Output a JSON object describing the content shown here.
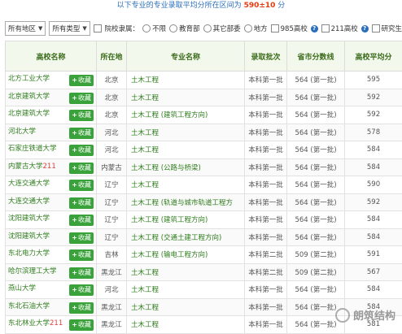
{
  "header": {
    "prefix": "以下专业的专业录取平均分所在区间为",
    "range": "590±10",
    "suffix": "分"
  },
  "filters": {
    "region_select": "所有地区",
    "type_select": "所有类型",
    "affiliation_label": "院校隶属：",
    "affiliation_options": [
      "不限",
      "教育部",
      "其它部委",
      "地方"
    ],
    "tags": [
      "985高校",
      "211高校",
      "研究生"
    ]
  },
  "table": {
    "columns": [
      "高校名称",
      "所在地",
      "专业名称",
      "录取批次",
      "省市分数线",
      "高校平均分"
    ],
    "fav_label": "收藏",
    "rows": [
      {
        "school": "北方工业大学",
        "tag": "",
        "location": "北京",
        "major": "土木工程",
        "batch": "本科第一批",
        "line": "564 (第一批)",
        "avg": "595"
      },
      {
        "school": "北京建筑大学",
        "tag": "",
        "location": "北京",
        "major": "土木工程",
        "batch": "本科第一批",
        "line": "564 (第一批)",
        "avg": "592"
      },
      {
        "school": "北京建筑大学",
        "tag": "",
        "location": "北京",
        "major": "土木工程 (建筑工程方向)",
        "batch": "本科第一批",
        "line": "564 (第一批)",
        "avg": "592"
      },
      {
        "school": "河北大学",
        "tag": "",
        "location": "河北",
        "major": "土木工程",
        "batch": "本科第一批",
        "line": "564 (第一批)",
        "avg": "578"
      },
      {
        "school": "石家庄铁道大学",
        "tag": "",
        "location": "河北",
        "major": "土木工程",
        "batch": "本科第一批",
        "line": "564 (第一批)",
        "avg": "584"
      },
      {
        "school": "内蒙古大学",
        "tag": "211",
        "location": "内蒙古",
        "major": "土木工程 (公路与桥梁)",
        "batch": "本科第一批",
        "line": "564 (第一批)",
        "avg": "584"
      },
      {
        "school": "大连交通大学",
        "tag": "",
        "location": "辽宁",
        "major": "土木工程",
        "batch": "本科第一批",
        "line": "564 (第一批)",
        "avg": "590"
      },
      {
        "school": "大连交通大学",
        "tag": "",
        "location": "辽宁",
        "major": "土木工程 (轨道与城市轨道工程方",
        "batch": "本科第一批",
        "line": "564 (第一批)",
        "avg": "592"
      },
      {
        "school": "沈阳建筑大学",
        "tag": "",
        "location": "辽宁",
        "major": "土木工程 (建筑工程方向)",
        "batch": "本科第一批",
        "line": "564 (第一批)",
        "avg": "584"
      },
      {
        "school": "沈阳建筑大学",
        "tag": "",
        "location": "辽宁",
        "major": "土木工程 (交通土建工程方向)",
        "batch": "本科第一批",
        "line": "564 (第一批)",
        "avg": "584"
      },
      {
        "school": "东北电力大学",
        "tag": "",
        "location": "吉林",
        "major": "土木工程 (输电工程方向)",
        "batch": "本科第二批",
        "line": "509 (第二批)",
        "avg": "591"
      },
      {
        "school": "哈尔滨理工大学",
        "tag": "",
        "location": "黑龙江",
        "major": "土木工程",
        "batch": "本科第二批",
        "line": "509 (第二批)",
        "avg": "567"
      },
      {
        "school": "燕山大学",
        "tag": "",
        "location": "河北",
        "major": "土木工程",
        "batch": "本科第一批",
        "line": "564 (第一批)",
        "avg": "584"
      },
      {
        "school": "东北石油大学",
        "tag": "",
        "location": "黑龙江",
        "major": "土木工程",
        "batch": "本科第一批",
        "line": "564 (第一批)",
        "avg": "584"
      },
      {
        "school": "东北林业大学",
        "tag": "211",
        "location": "黑龙江",
        "major": "土木工程",
        "batch": "本科第一批",
        "line": "564 (第一批)",
        "avg": "581"
      }
    ]
  },
  "watermark": "朗筑结构"
}
